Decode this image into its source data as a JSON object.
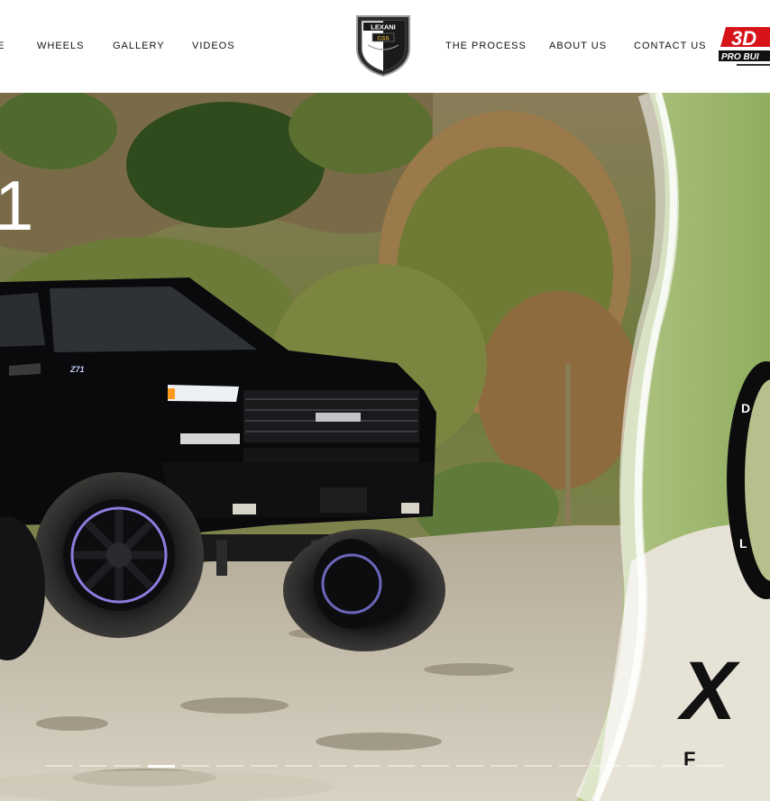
{
  "header": {
    "nav_left": [
      {
        "label": "E",
        "name": "nav-home-partial"
      },
      {
        "label": "WHEELS",
        "name": "nav-wheels"
      },
      {
        "label": "GALLERY",
        "name": "nav-gallery"
      },
      {
        "label": "VIDEOS",
        "name": "nav-videos"
      }
    ],
    "nav_right": [
      {
        "label": "THE PROCESS",
        "name": "nav-the-process"
      },
      {
        "label": "ABOUT US",
        "name": "nav-about-us"
      },
      {
        "label": "CONTACT US",
        "name": "nav-contact-us"
      }
    ],
    "logo_center": {
      "brand": "LEXANI",
      "sub": "CSS",
      "icon": "lexani-shield-logo"
    },
    "logo_right": {
      "brand": "3D",
      "tagline": "PRO BUI",
      "icon": "3d-pro-builders-logo"
    }
  },
  "hero": {
    "big_digit": "1",
    "truck_badge": "Z71",
    "wheel_letters": [
      "D",
      "L"
    ],
    "promo_mark": "X",
    "promo_letters": "F C",
    "slide_count": 20,
    "active_slide": 3
  },
  "colors": {
    "nav_text": "#111111",
    "brand_red": "#d7141a",
    "indicator_active": "#ffffff"
  }
}
